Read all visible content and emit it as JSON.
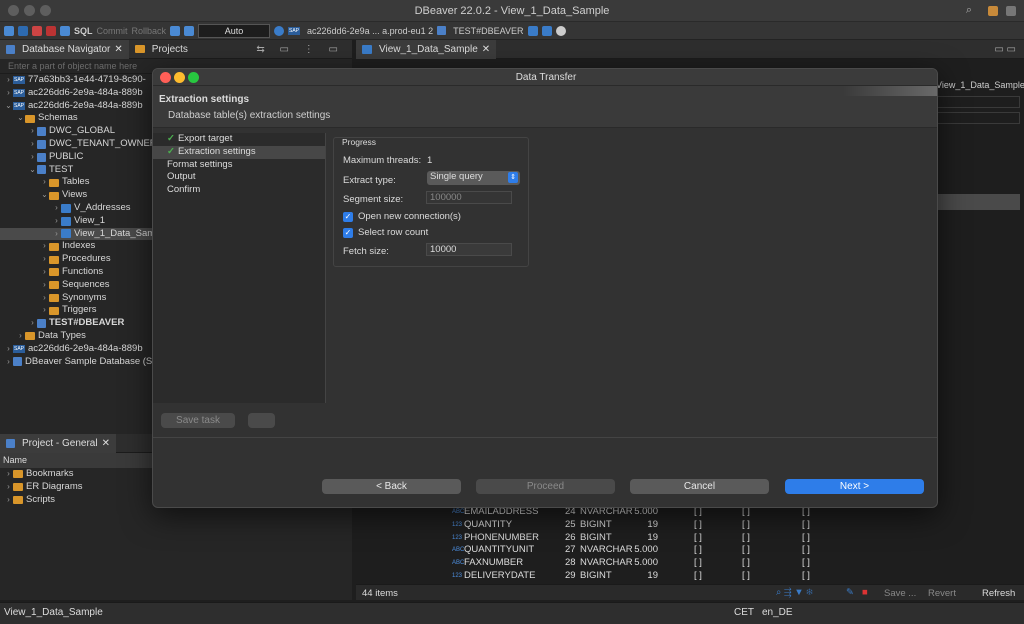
{
  "window": {
    "title": "DBeaver 22.0.2 - View_1_Data_Sample"
  },
  "toolbar": {
    "sql_label": "SQL",
    "commit_label": "Commit",
    "rollback_label": "Rollback",
    "auto_label": "Auto",
    "connection_label": "ac226dd6-2e9a ... a.prod-eu1 2",
    "schema_label": "TEST#DBEAVER"
  },
  "navigator": {
    "tab_db": "Database Navigator",
    "tab_projects": "Projects",
    "filter_placeholder": "Enter a part of object name here",
    "tree": [
      {
        "label": "77a63bb3-1e44-4719-8c90-",
        "level": 0,
        "icon": "sap",
        "arrow": "›"
      },
      {
        "label": "ac226dd6-2e9a-484a-889b",
        "level": 0,
        "icon": "sap",
        "arrow": "›"
      },
      {
        "label": "ac226dd6-2e9a-484a-889b",
        "level": 0,
        "icon": "sap",
        "arrow": "⌄"
      },
      {
        "label": "Schemas",
        "level": 1,
        "icon": "folder",
        "arrow": "⌄"
      },
      {
        "label": "DWC_GLOBAL",
        "level": 2,
        "icon": "db",
        "arrow": "›"
      },
      {
        "label": "DWC_TENANT_OWNER",
        "level": 2,
        "icon": "db",
        "arrow": "›"
      },
      {
        "label": "PUBLIC",
        "level": 2,
        "icon": "db",
        "arrow": "›"
      },
      {
        "label": "TEST",
        "level": 2,
        "icon": "db",
        "arrow": "⌄"
      },
      {
        "label": "Tables",
        "level": 3,
        "icon": "folder",
        "arrow": "›"
      },
      {
        "label": "Views",
        "level": 3,
        "icon": "folder",
        "arrow": "⌄"
      },
      {
        "label": "V_Addresses",
        "level": 4,
        "icon": "view",
        "arrow": "›"
      },
      {
        "label": "View_1",
        "level": 4,
        "icon": "view",
        "arrow": "›"
      },
      {
        "label": "View_1_Data_Sam",
        "level": 4,
        "icon": "view",
        "arrow": "›",
        "selected": true
      },
      {
        "label": "Indexes",
        "level": 3,
        "icon": "folder",
        "arrow": "›"
      },
      {
        "label": "Procedures",
        "level": 3,
        "icon": "folder",
        "arrow": "›"
      },
      {
        "label": "Functions",
        "level": 3,
        "icon": "folder",
        "arrow": "›"
      },
      {
        "label": "Sequences",
        "level": 3,
        "icon": "folder",
        "arrow": "›"
      },
      {
        "label": "Synonyms",
        "level": 3,
        "icon": "folder",
        "arrow": "›"
      },
      {
        "label": "Triggers",
        "level": 3,
        "icon": "folder",
        "arrow": "›"
      },
      {
        "label": "TEST#DBEAVER",
        "level": 2,
        "icon": "db",
        "arrow": "›"
      },
      {
        "label": "Data Types",
        "level": 1,
        "icon": "folder",
        "arrow": "›"
      },
      {
        "label": "ac226dd6-2e9a-484a-889b",
        "level": 0,
        "icon": "sap",
        "arrow": "›"
      },
      {
        "label": "DBeaver Sample Database (S",
        "level": 0,
        "icon": "db",
        "arrow": "›"
      }
    ]
  },
  "project": {
    "tab": "Project - General",
    "col_name": "Name",
    "items": [
      "Bookmarks",
      "ER Diagrams",
      "Scripts"
    ]
  },
  "editor": {
    "tab": "View_1_Data_Sample",
    "subtab_partial": "View_1_Data_Sample",
    "rows": [
      {
        "type": "ABC",
        "name": "EMAILADDRESS",
        "pos": "24",
        "dtype": "NVARCHAR",
        "len": "5.000"
      },
      {
        "type": "123",
        "name": "QUANTITY",
        "pos": "25",
        "dtype": "BIGINT",
        "len": "19"
      },
      {
        "type": "123",
        "name": "PHONENUMBER",
        "pos": "26",
        "dtype": "BIGINT",
        "len": "19"
      },
      {
        "type": "ABC",
        "name": "QUANTITYUNIT",
        "pos": "27",
        "dtype": "NVARCHAR",
        "len": "5.000"
      },
      {
        "type": "ABC",
        "name": "FAXNUMBER",
        "pos": "28",
        "dtype": "NVARCHAR",
        "len": "5.000"
      },
      {
        "type": "123",
        "name": "DELIVERYDATE",
        "pos": "29",
        "dtype": "BIGINT",
        "len": "19"
      }
    ],
    "bracket": "[ ]",
    "items_count": "44 items",
    "save_label": "Save ...",
    "revert_label": "Revert",
    "refresh_label": "Refresh"
  },
  "status": {
    "left": "View_1_Data_Sample",
    "tz": "CET",
    "locale": "en_DE"
  },
  "dialog": {
    "title": "Data Transfer",
    "heading": "Extraction settings",
    "subheading": "Database table(s) extraction settings",
    "steps": [
      {
        "label": "Export target",
        "done": true
      },
      {
        "label": "Extraction settings",
        "done": true,
        "selected": true
      },
      {
        "label": "Format settings"
      },
      {
        "label": "Output"
      },
      {
        "label": "Confirm"
      }
    ],
    "group_title": "Progress",
    "max_threads_label": "Maximum threads:",
    "max_threads_value": "1",
    "extract_type_label": "Extract type:",
    "extract_type_value": "Single query",
    "segment_size_label": "Segment size:",
    "segment_size_value": "100000",
    "open_conn_label": "Open new connection(s)",
    "open_conn_checked": true,
    "select_count_label": "Select row count",
    "select_count_checked": true,
    "fetch_size_label": "Fetch size:",
    "fetch_size_value": "10000",
    "save_task_label": "Save task",
    "back_label": "< Back",
    "proceed_label": "Proceed",
    "cancel_label": "Cancel",
    "next_label": "Next >"
  },
  "colors": {
    "accent": "#2e7de9",
    "check": "#4caf50",
    "folder": "#d9962a"
  }
}
